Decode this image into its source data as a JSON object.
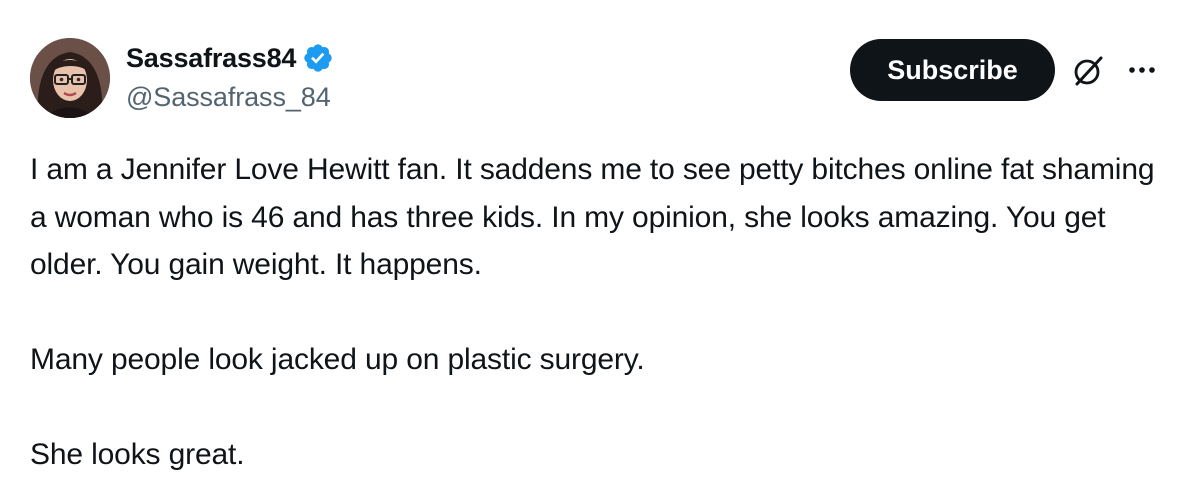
{
  "author": {
    "display_name": "Sassafrass84",
    "handle": "@Sassafrass_84",
    "verified": true,
    "verified_color": "#1d9bf0"
  },
  "actions": {
    "subscribe_label": "Subscribe",
    "grok_icon": "grok-icon",
    "more_icon": "more-options-icon"
  },
  "tweet": {
    "paragraphs": [
      "I am a Jennifer Love Hewitt fan. It saddens me to see petty bitches online fat shaming a woman who is 46 and has three kids. In my opinion, she looks amazing. You get older. You gain weight. It happens.",
      "Many people look jacked up on plastic surgery.",
      "She looks great."
    ]
  },
  "colors": {
    "text": "#0f1419",
    "secondary_text": "#536471",
    "button_bg": "#0f1419",
    "button_text": "#ffffff"
  }
}
